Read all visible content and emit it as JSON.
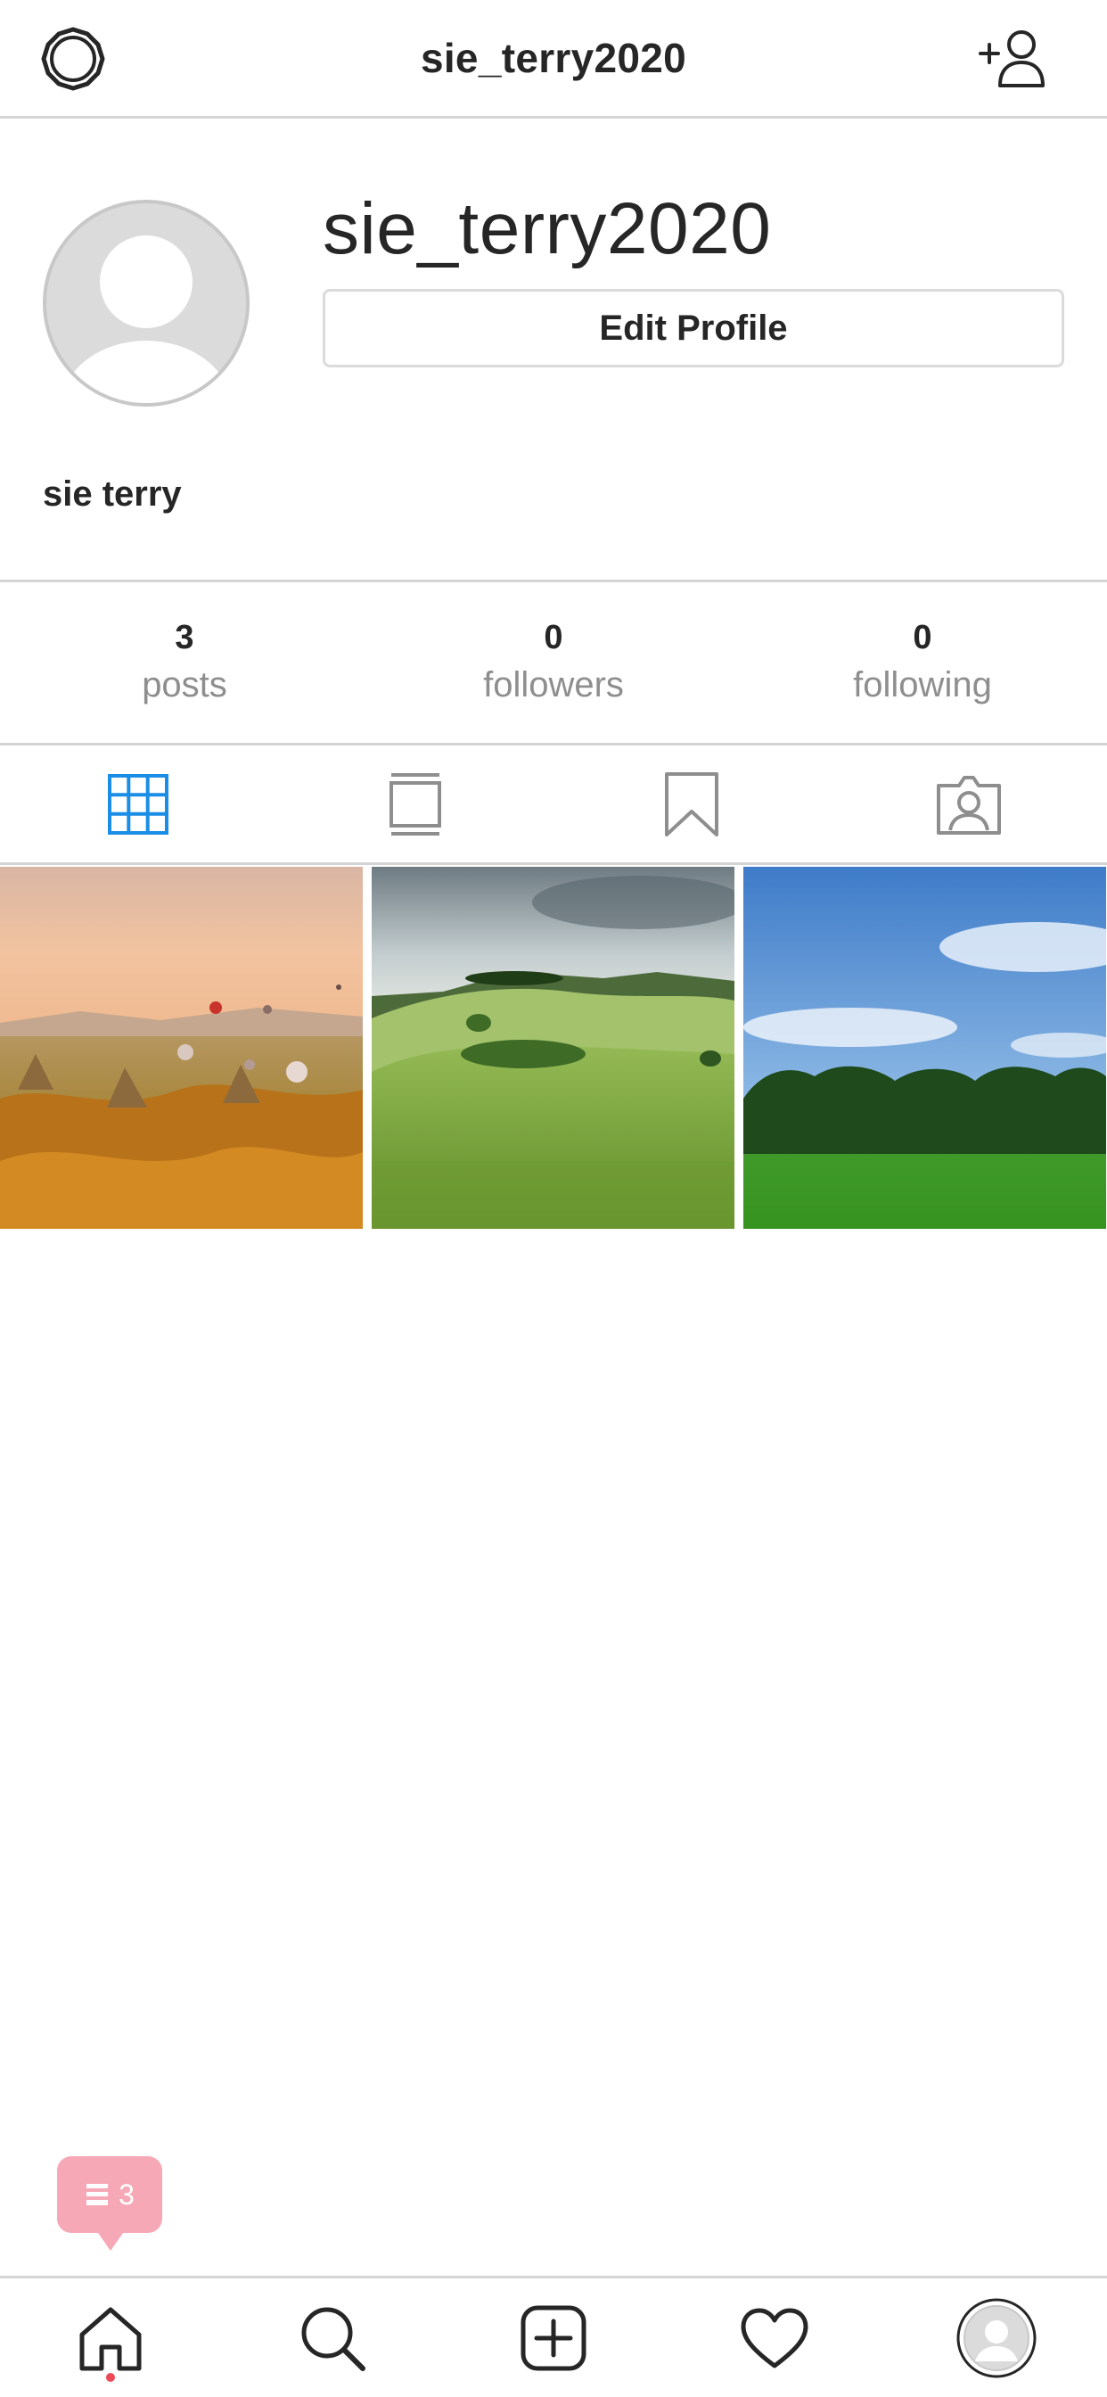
{
  "header": {
    "title": "sie_terry2020",
    "left_icon": "settings-gear-icon",
    "right_icon": "add-user-icon"
  },
  "profile": {
    "username": "sie_terry2020",
    "edit_button_label": "Edit Profile",
    "display_name": "sie terry",
    "avatar_icon": "default-avatar-icon"
  },
  "stats": [
    {
      "value": "3",
      "label": "posts"
    },
    {
      "value": "0",
      "label": "followers"
    },
    {
      "value": "0",
      "label": "following"
    }
  ],
  "tabs": [
    {
      "icon": "grid-icon",
      "active": true
    },
    {
      "icon": "feed-list-icon",
      "active": false
    },
    {
      "icon": "bookmark-icon",
      "active": false
    },
    {
      "icon": "tagged-user-icon",
      "active": false
    }
  ],
  "posts": [
    {
      "subject": "hot air balloons over canyon landscape"
    },
    {
      "subject": "green rolling hills with trees"
    },
    {
      "subject": "green field with tree line and blue sky"
    }
  ],
  "notification": {
    "count": "3",
    "icon": "comment-icon"
  },
  "bottom_nav": [
    {
      "icon": "home-icon"
    },
    {
      "icon": "search-icon"
    },
    {
      "icon": "add-post-icon"
    },
    {
      "icon": "heart-icon"
    },
    {
      "icon": "profile-avatar-icon"
    }
  ],
  "colors": {
    "accent": "#1a8ee6",
    "divider": "#d4d4d4",
    "muted": "#8e8e8e",
    "badge": "#f7a8b6",
    "dot": "#ed4956"
  }
}
